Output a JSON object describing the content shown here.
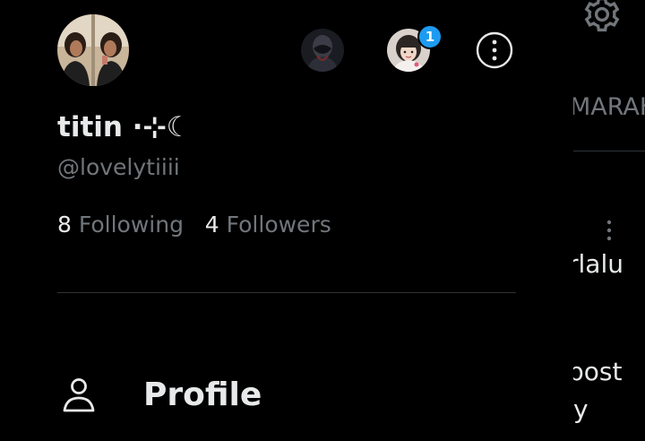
{
  "profile": {
    "display_name": "titin ⋅⊹☾",
    "handle": "@lovelytiiii",
    "following_count": "8",
    "following_label": "Following",
    "followers_count": "4",
    "followers_label": "Followers",
    "notification_badge": "1"
  },
  "menu": {
    "profile_label": "Profile"
  },
  "background_peek": {
    "tab_label": "MARAH",
    "line1": "rlalu",
    "line2": "post",
    "line3": "y"
  },
  "colors": {
    "background": "#000000",
    "primary_text": "#e7e9ea",
    "secondary_text": "#71767b",
    "divider": "#2f3336",
    "badge": "#1d9bf0"
  },
  "icons": {
    "more": "more-circle-icon",
    "profile": "person-icon",
    "settings": "gear-icon"
  }
}
